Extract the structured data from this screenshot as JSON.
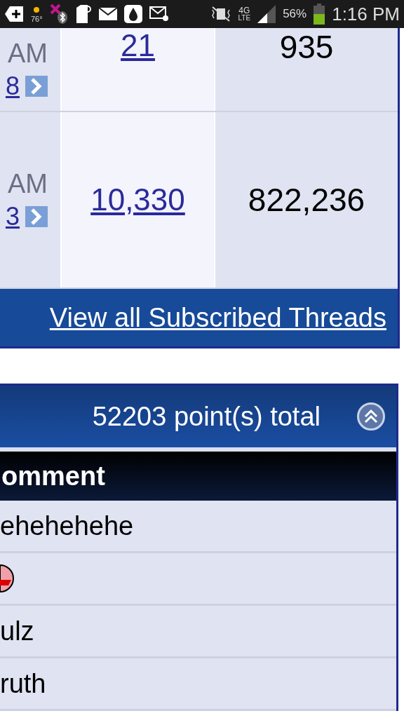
{
  "status_bar": {
    "weather": "76°",
    "network": "4G",
    "network_sub": "LTE",
    "battery": "56%",
    "time": "1:16 PM"
  },
  "threads_table": {
    "rows": [
      {
        "time": "AM",
        "link": "8",
        "replies": "21",
        "views": "935"
      },
      {
        "time": "AM",
        "link": "3",
        "replies": "10,330",
        "views": "822,236"
      }
    ],
    "footer_link": "View all Subscribed Threads"
  },
  "points_panel": {
    "title": "52203 point(s) total",
    "expanded": true,
    "column": "omment",
    "rows": [
      {
        "kind": "text",
        "comment": "ehehehehe"
      },
      {
        "kind": "smiley"
      },
      {
        "kind": "text",
        "comment": "ulz"
      },
      {
        "kind": "text",
        "comment": "ruth"
      }
    ]
  }
}
